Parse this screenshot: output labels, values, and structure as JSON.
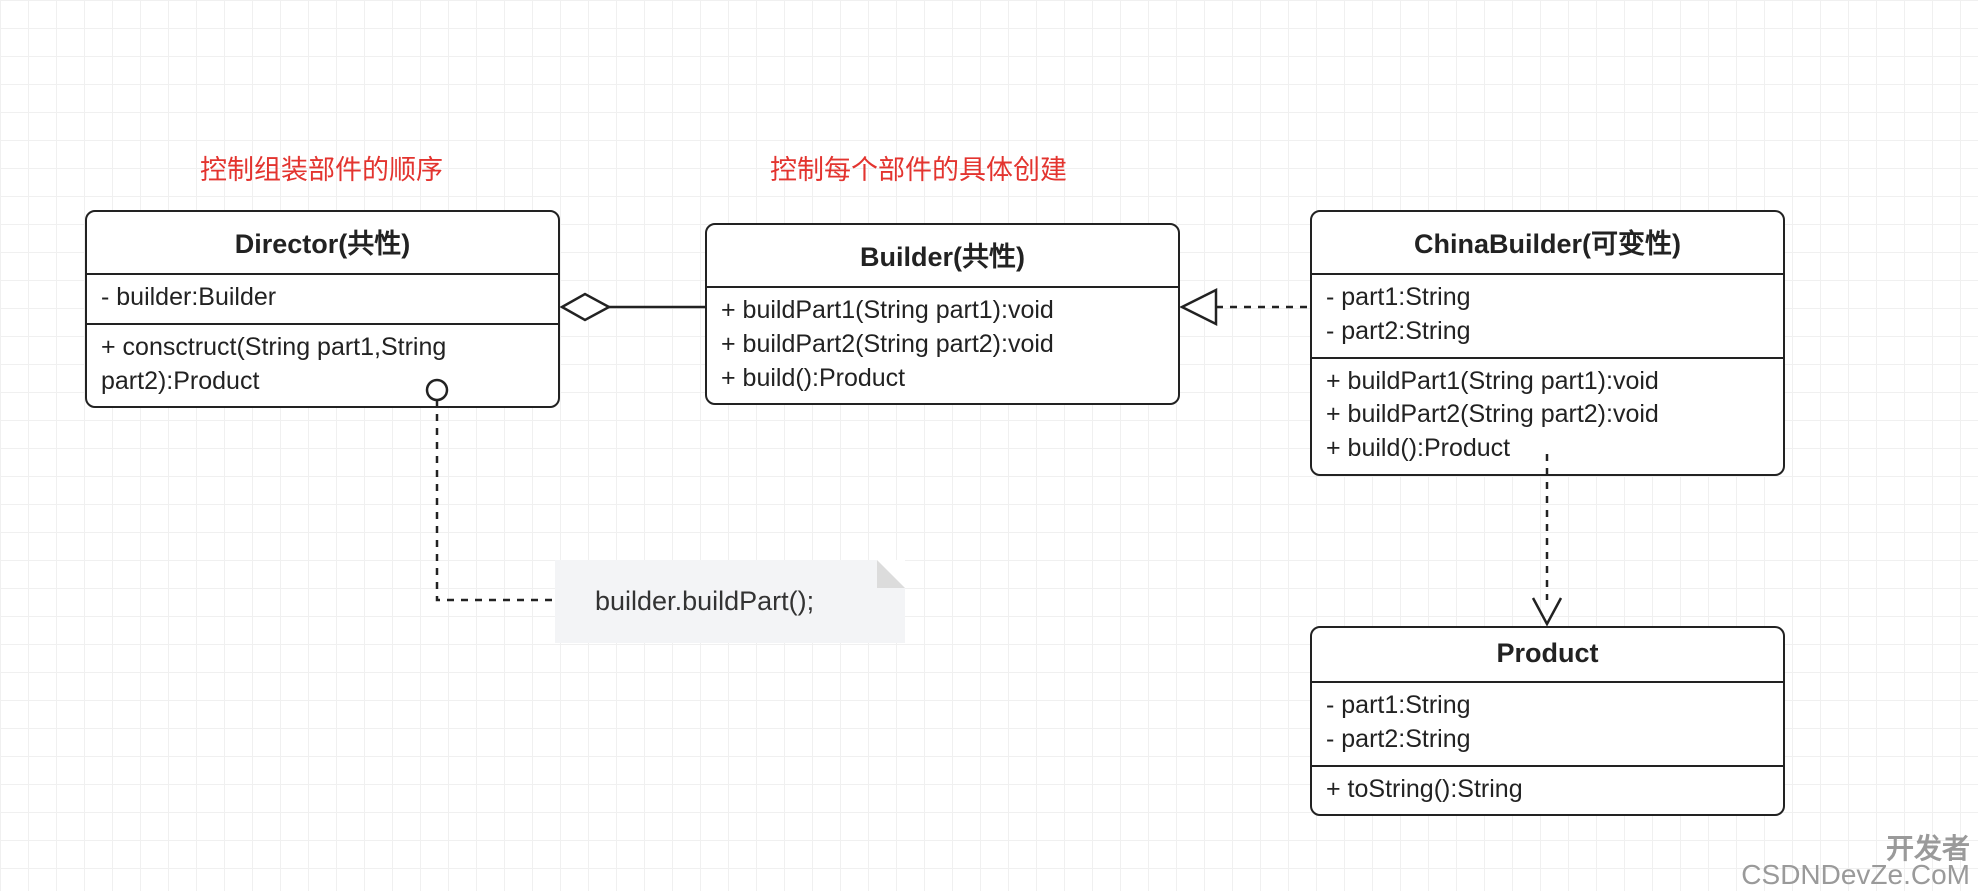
{
  "annotations": {
    "left": "控制组装部件的顺序",
    "middle": "控制每个部件的具体创建"
  },
  "director": {
    "title": "Director(共性)",
    "attrs": "- builder:Builder",
    "ops": "+ consctruct(String part1,String part2):Product"
  },
  "builder": {
    "title": "Builder(共性)",
    "op1": "+ buildPart1(String part1):void",
    "op2": "+ buildPart2(String part2):void",
    "op3": "+ build():Product"
  },
  "chinaBuilder": {
    "title": "ChinaBuilder(可变性)",
    "attr1": "- part1:String",
    "attr2": "- part2:String",
    "op1": "+ buildPart1(String part1):void",
    "op2": "+ buildPart2(String part2):void",
    "op3": "+ build():Product"
  },
  "product": {
    "title": "Product",
    "attr1": "- part1:String",
    "attr2": "- part2:String",
    "op1": "+ toString():String"
  },
  "note": "builder.buildPart();",
  "watermark": {
    "line1": "开发者",
    "line2": "CSDNDevZe.CoM"
  }
}
